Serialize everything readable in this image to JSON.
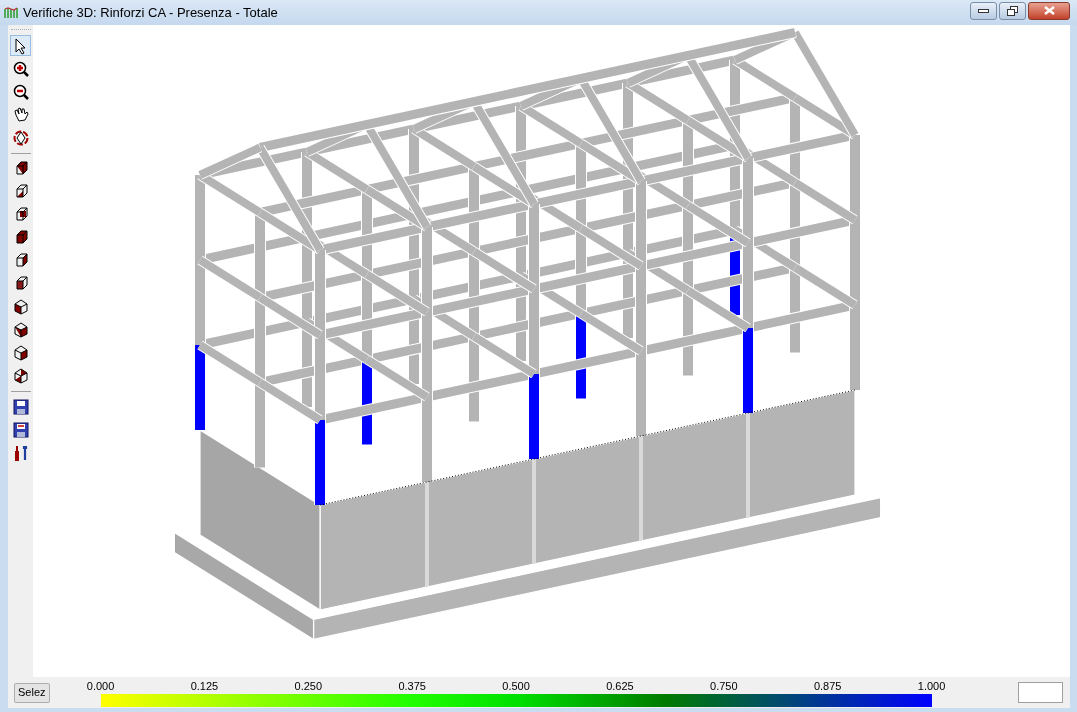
{
  "window": {
    "title": "Verifiche 3D: Rinforzi CA - Presenza - Totale"
  },
  "toolbar_groups": [
    {
      "tools": [
        {
          "kind": "pointer",
          "selected": true
        },
        {
          "kind": "zoom-in",
          "selected": false
        },
        {
          "kind": "zoom-out",
          "selected": false
        },
        {
          "kind": "pan",
          "selected": false
        },
        {
          "kind": "rotate",
          "selected": false
        }
      ]
    },
    {
      "tools": [
        {
          "kind": "view",
          "selected": false
        },
        {
          "kind": "view",
          "selected": false
        },
        {
          "kind": "view",
          "selected": false
        },
        {
          "kind": "view",
          "selected": false
        },
        {
          "kind": "view",
          "selected": false
        },
        {
          "kind": "view",
          "selected": false
        },
        {
          "kind": "view",
          "selected": false
        },
        {
          "kind": "view",
          "selected": false
        },
        {
          "kind": "view",
          "selected": false
        },
        {
          "kind": "view",
          "selected": false
        }
      ]
    },
    {
      "tools": [
        {
          "kind": "save",
          "selected": false
        },
        {
          "kind": "save-as",
          "selected": false
        },
        {
          "kind": "tools",
          "selected": false
        }
      ]
    }
  ],
  "select_button": "Selez",
  "legend": {
    "labels": [
      "0.000",
      "0.125",
      "0.250",
      "0.375",
      "0.500",
      "0.625",
      "0.750",
      "0.875",
      "1.000"
    ]
  }
}
